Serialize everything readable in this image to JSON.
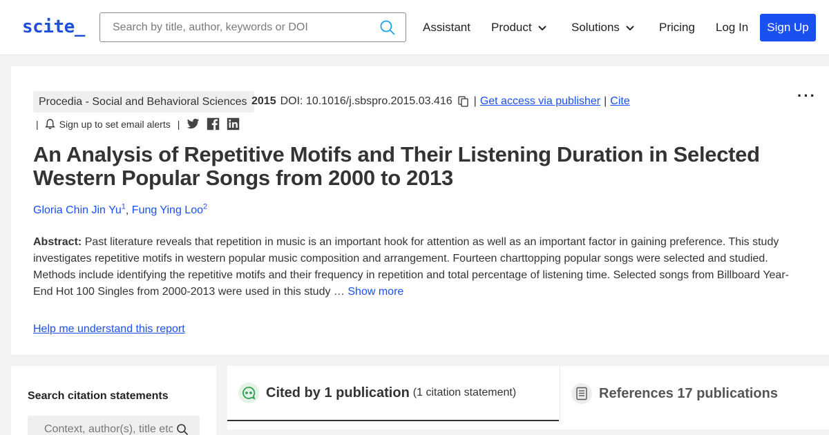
{
  "header": {
    "logo": "scite_",
    "search_placeholder": "Search by title, author, keywords or DOI",
    "nav": {
      "assistant": "Assistant",
      "product": "Product",
      "solutions": "Solutions",
      "pricing": "Pricing",
      "login": "Log In",
      "signup": "Sign Up"
    }
  },
  "paper": {
    "journal": "Procedia - Social and Behavioral Sciences",
    "year": "2015",
    "doi": "DOI: 10.1016/j.sbspro.2015.03.416",
    "access_link": "Get access via publisher",
    "cite_link": "Cite",
    "alerts": "Sign up to set email alerts",
    "title": "An Analysis of Repetitive Motifs and Their Listening Duration in Selected Western Popular Songs from 2000 to 2013",
    "authors": [
      {
        "name": "Gloria Chin Jin Yu",
        "sup": "1"
      },
      {
        "name": "Fung Ying Loo",
        "sup": "2"
      }
    ],
    "abstract_label": "Abstract:",
    "abstract_text": "Past literature reveals that repetition in music is an important hook for attention as well as an important factor in gaining preference. This study investigates repetitive motifs in western popular music composition and arrangement. Fourteen charttopping popular songs were selected and studied. Methods include identifying the repetitive motifs and their frequency in repetition and total percentage of listening time. Selected songs from Billboard Year-End Hot 100 Singles from 2000-2013 were used in this study …",
    "show_more": "Show more",
    "help_link": "Help me understand this report"
  },
  "sidebar": {
    "title": "Search citation statements",
    "search_placeholder": "Context, author(s), title etc."
  },
  "tabs": {
    "cited": {
      "label": "Cited by 1 publication",
      "sub": "(1 citation statement)"
    },
    "refs": {
      "label": "References 17 publications"
    }
  },
  "colors": {
    "brand": "#1a4ff0",
    "cited_icon": "#2e9e4f"
  }
}
